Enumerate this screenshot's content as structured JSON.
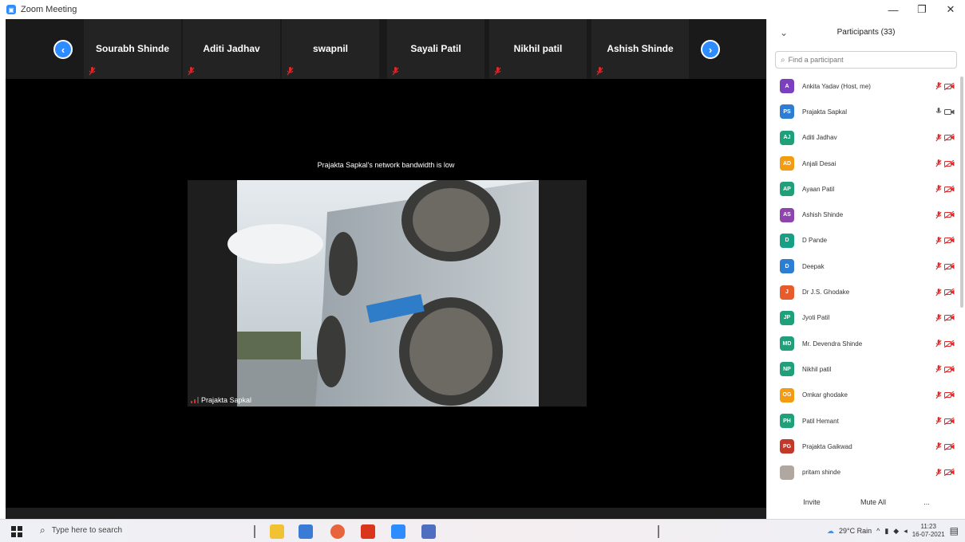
{
  "window": {
    "title": "Zoom Meeting"
  },
  "strip": {
    "tiles": [
      {
        "name": "Sourabh Shinde"
      },
      {
        "name": "Aditi Jadhav"
      },
      {
        "name": "swapnil"
      },
      {
        "name": "Sayali Patil"
      },
      {
        "name": "Nikhil patil"
      },
      {
        "name": "Ashish Shinde"
      }
    ]
  },
  "video": {
    "network_message": "Prajakta Sapkal's network bandwidth is low",
    "presenter_name": "Prajakta Sapkal"
  },
  "panel": {
    "title": "Participants (33)",
    "search_placeholder": "Find a participant",
    "participants": [
      {
        "initials": "A",
        "name": "Ankita Yadav (Host, me)",
        "color": "#7b3fbf",
        "mic": "muted",
        "video": "Off"
      },
      {
        "initials": "PS",
        "name": "Prajakta Sapkal",
        "color": "#2d7dd2",
        "mic": "on",
        "video": "On"
      },
      {
        "initials": "AJ",
        "name": "Aditi Jadhav",
        "color": "#1f9f7a",
        "mic": "muted",
        "video": "Off"
      },
      {
        "initials": "AD",
        "name": "Anjali Desai",
        "color": "#f39c12",
        "mic": "muted",
        "video": "Off"
      },
      {
        "initials": "AP",
        "name": "Ayaan Patil",
        "color": "#1f9f7a",
        "mic": "muted",
        "video": "Off"
      },
      {
        "initials": "AS",
        "name": "Ashish Shinde",
        "color": "#8e44ad",
        "mic": "muted",
        "video": "Off"
      },
      {
        "initials": "D",
        "name": "D Pande",
        "color": "#16a085",
        "mic": "muted",
        "video": "Off"
      },
      {
        "initials": "D",
        "name": "Deepak",
        "color": "#2d7dd2",
        "mic": "muted",
        "video": "Off"
      },
      {
        "initials": "J",
        "name": "Dr J.S. Ghodake",
        "color": "#e65c2c",
        "mic": "muted",
        "video": "Off"
      },
      {
        "initials": "JP",
        "name": "Jyoti Patil",
        "color": "#1f9f7a",
        "mic": "muted",
        "video": "Off"
      },
      {
        "initials": "MD",
        "name": "Mr. Devendra Shinde",
        "color": "#1f9f7a",
        "mic": "muted",
        "video": "Off"
      },
      {
        "initials": "NP",
        "name": "Nikhil patil",
        "color": "#1f9f7a",
        "mic": "muted",
        "video": "Off"
      },
      {
        "initials": "OG",
        "name": "Omkar ghodake",
        "color": "#f39c12",
        "mic": "muted",
        "video": "Off"
      },
      {
        "initials": "PH",
        "name": "Patil Hemant",
        "color": "#1f9f7a",
        "mic": "muted",
        "video": "Off"
      },
      {
        "initials": "PG",
        "name": "Prajakta Gaikwad",
        "color": "#c0392b",
        "mic": "muted",
        "video": "Off"
      },
      {
        "initials": "",
        "name": "pritam shinde",
        "color": "#b0a8a0",
        "mic": "muted",
        "video": "Off"
      }
    ],
    "footer": {
      "invite": "Invite",
      "mute_all": "Mute All",
      "more": "..."
    }
  },
  "taskbar": {
    "search_text": "Type here to search",
    "weather": "29°C Rain",
    "time": "11:23",
    "date": "16-07-2021"
  },
  "colors": {
    "zoom_blue": "#2d8cff",
    "muted_red": "#e02828"
  }
}
